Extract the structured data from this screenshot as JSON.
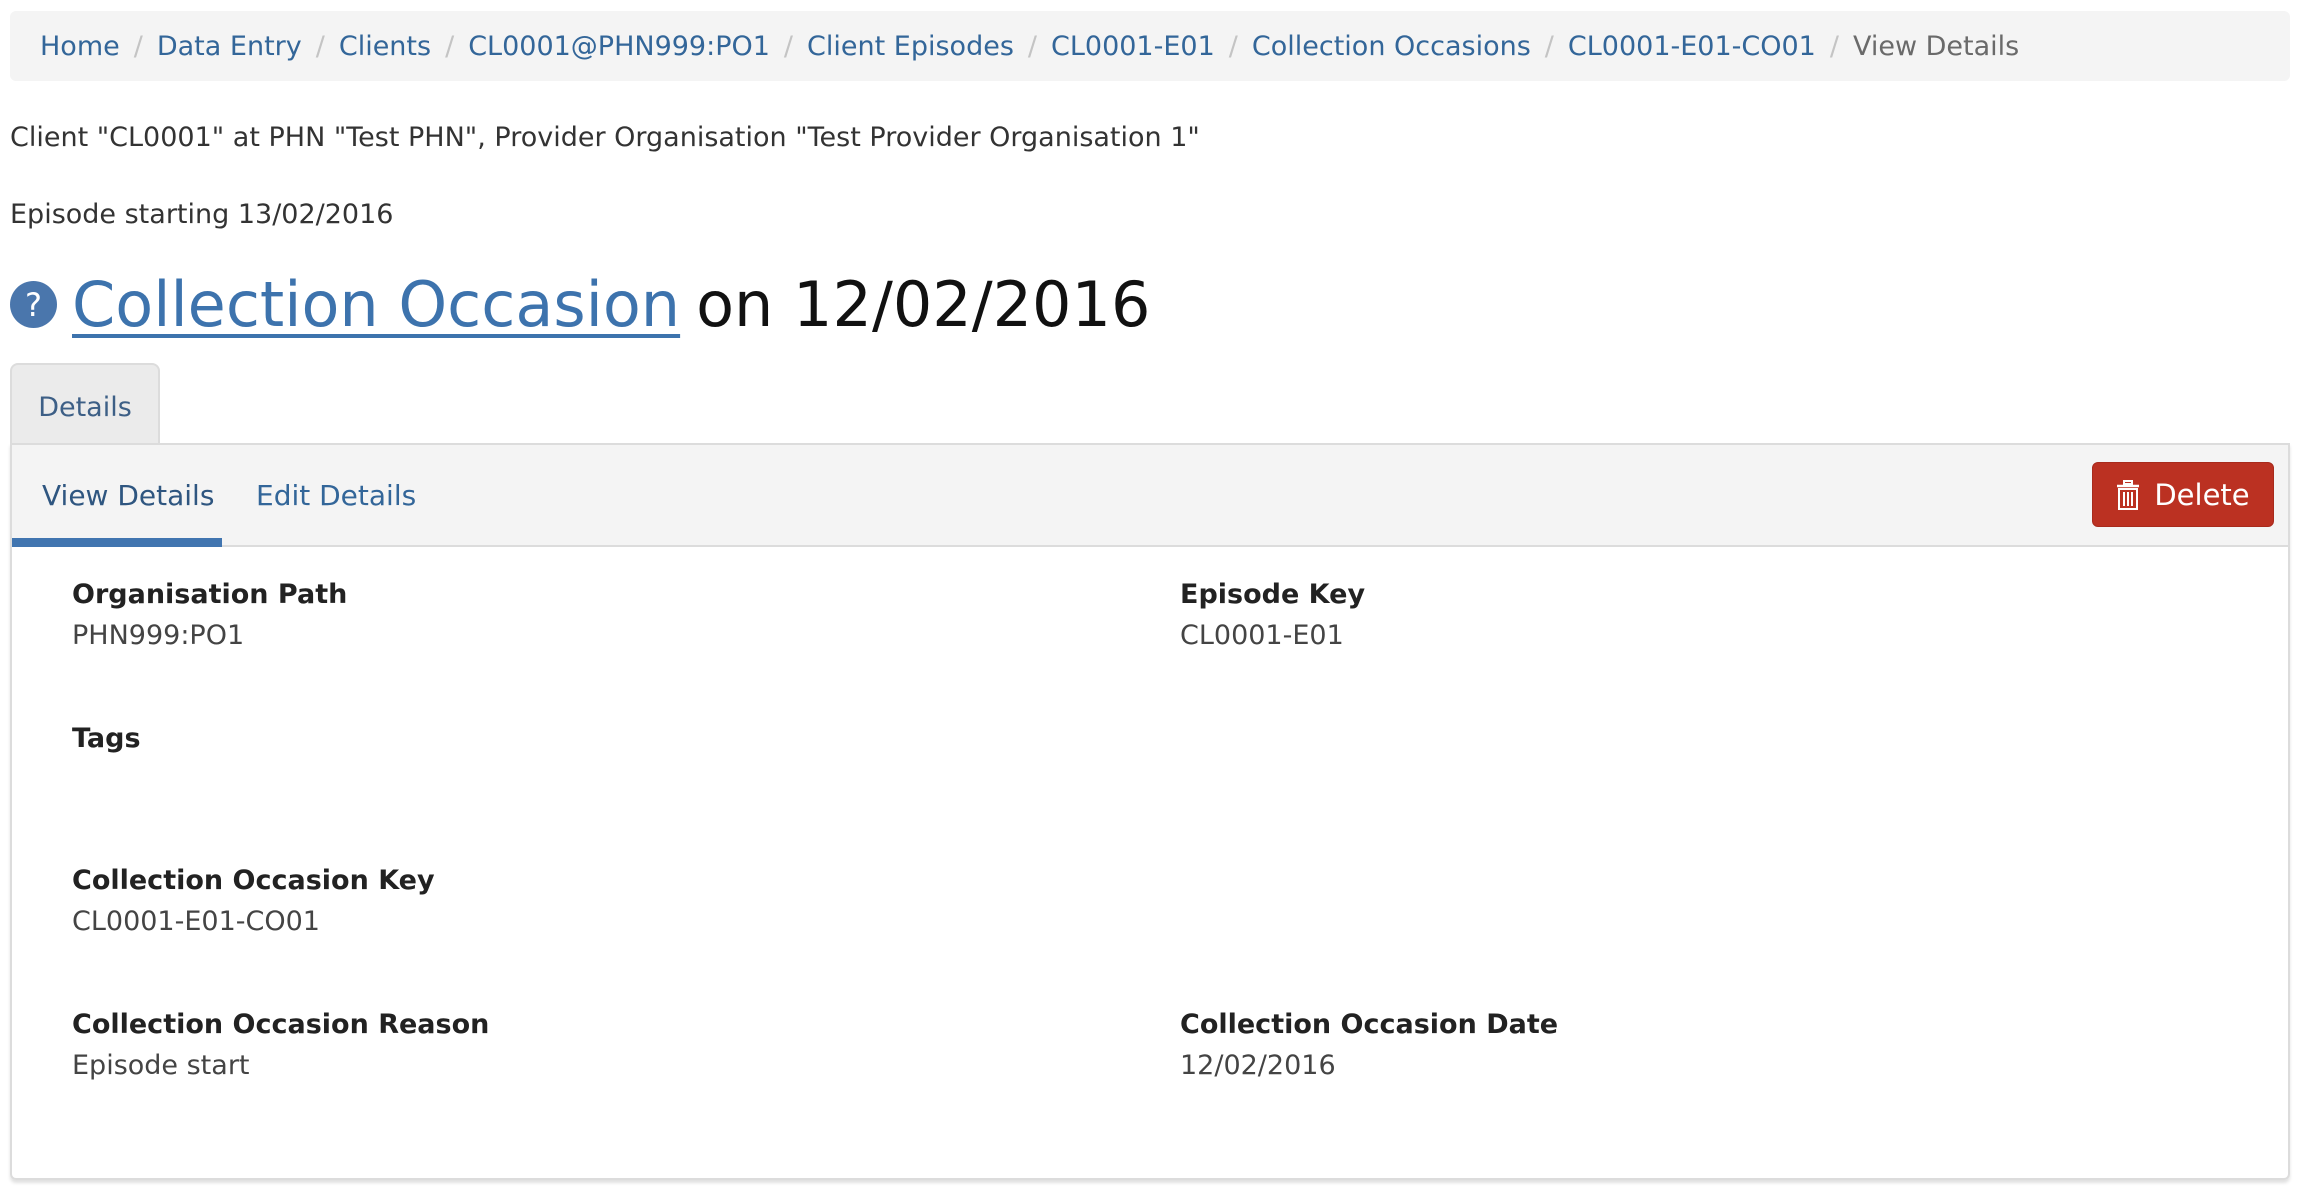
{
  "breadcrumb": [
    {
      "label": "Home",
      "link": true
    },
    {
      "label": "Data Entry",
      "link": true
    },
    {
      "label": "Clients",
      "link": true
    },
    {
      "label": "CL0001@PHN999:PO1",
      "link": true
    },
    {
      "label": "Client Episodes",
      "link": true
    },
    {
      "label": "CL0001-E01",
      "link": true
    },
    {
      "label": "Collection Occasions",
      "link": true
    },
    {
      "label": "CL0001-E01-CO01",
      "link": true
    },
    {
      "label": "View Details",
      "link": false
    }
  ],
  "context": {
    "client_line": "Client \"CL0001\" at PHN \"Test PHN\", Provider Organisation \"Test Provider Organisation 1\"",
    "episode_line": "Episode starting 13/02/2016"
  },
  "title": {
    "help_icon": "?",
    "link_text": "Collection Occasion",
    "rest": "on 12/02/2016"
  },
  "tabs": {
    "main": "Details",
    "sub": [
      "View Details",
      "Edit Details"
    ],
    "active_sub": "View Details"
  },
  "actions": {
    "delete_label": "Delete",
    "delete_icon": "trash-icon",
    "delete_color": "#bb3122"
  },
  "fields": {
    "organisation_path": {
      "label": "Organisation Path",
      "value": "PHN999:PO1"
    },
    "episode_key": {
      "label": "Episode Key",
      "value": "CL0001-E01"
    },
    "tags": {
      "label": "Tags",
      "value": ""
    },
    "collection_occasion_key": {
      "label": "Collection Occasion Key",
      "value": "CL0001-E01-CO01"
    },
    "collection_occasion_reason": {
      "label": "Collection Occasion Reason",
      "value": "Episode start"
    },
    "collection_occasion_date": {
      "label": "Collection Occasion Date",
      "value": "12/02/2016"
    }
  },
  "colors": {
    "link": "#336699",
    "accent": "#4175b0",
    "danger": "#bb3122"
  }
}
